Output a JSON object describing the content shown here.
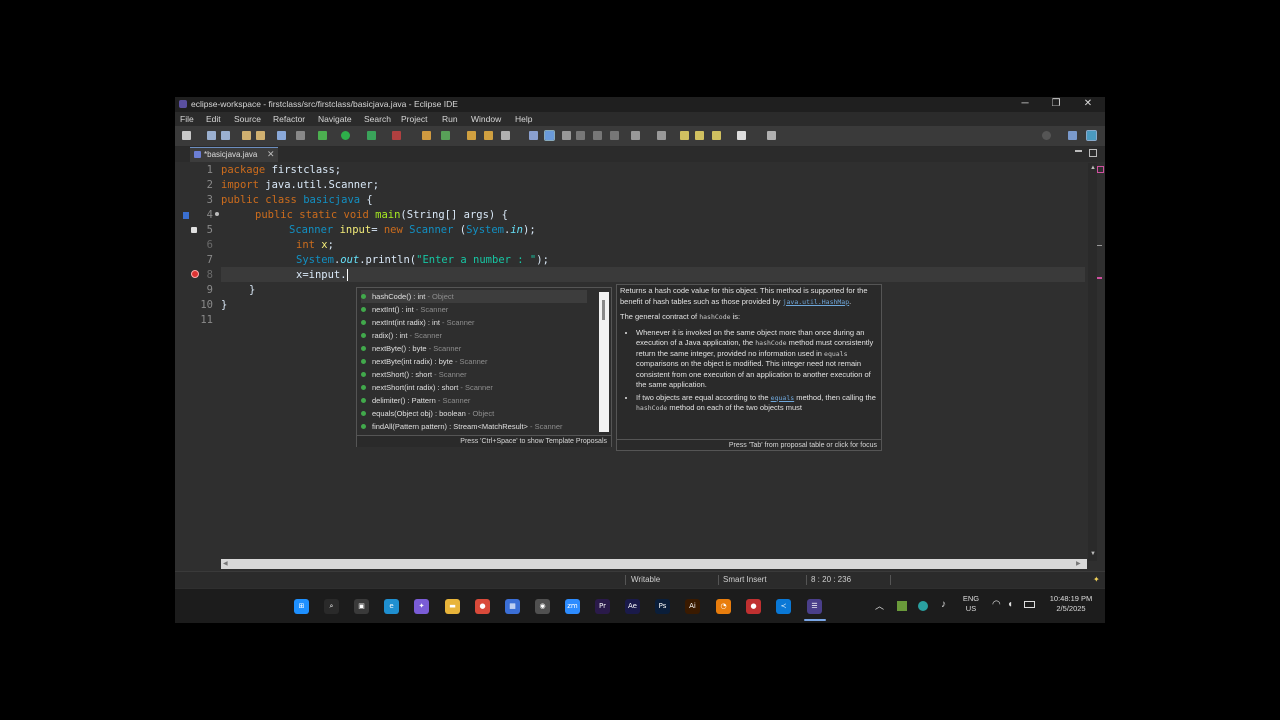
{
  "window": {
    "title": "eclipse-workspace - firstclass/src/firstclass/basicjava.java - Eclipse IDE",
    "controls": [
      "─",
      "❐",
      "✕"
    ]
  },
  "menu": [
    "File",
    "Edit",
    "Source",
    "Refactor",
    "Navigate",
    "Search",
    "Project",
    "Run",
    "Window",
    "Help"
  ],
  "editor": {
    "tab_label": "*basicjava.java",
    "tab_close": "✕",
    "line_numbers": [
      "1",
      "2",
      "3",
      "4",
      "5",
      "6",
      "7",
      "8",
      "9",
      "10",
      "11"
    ],
    "lines": {
      "l1": {
        "kw": "package",
        "rest": " firstclass;"
      },
      "l2": {
        "kw": "import",
        "rest": " java.util.Scanner;"
      },
      "l3": {
        "kw": "public class",
        "name": "basicjava",
        "rest": " {"
      },
      "l4": {
        "kw": "public static void",
        "method": "main",
        "rest": "(String[] args) {"
      },
      "l5": {
        "type": "Scanner",
        "var": "input",
        "op": "= ",
        "kw": "new",
        "type2": "Scanner",
        "paren": " (",
        "cls": "System",
        "dot": ".",
        "field": "in",
        "end": ");"
      },
      "l6": {
        "kw": "int",
        "var": "x",
        "end": ";"
      },
      "l7": {
        "cls": "System",
        "dot": ".",
        "field": "out",
        "call": ".println(",
        "str": "\"Enter a number : \"",
        "end": ");"
      },
      "l8": {
        "text": "x=input."
      },
      "l9": {
        "text": "}"
      },
      "l10": {
        "text": "}"
      }
    }
  },
  "completion": {
    "items": [
      {
        "name": "hashCode() : int",
        "qualifier": " - Object"
      },
      {
        "name": "nextInt() : int",
        "qualifier": " - Scanner"
      },
      {
        "name": "nextInt(int radix) : int",
        "qualifier": " - Scanner"
      },
      {
        "name": "radix() : int",
        "qualifier": " - Scanner"
      },
      {
        "name": "nextByte() : byte",
        "qualifier": " - Scanner"
      },
      {
        "name": "nextByte(int radix) : byte",
        "qualifier": " - Scanner"
      },
      {
        "name": "nextShort() : short",
        "qualifier": " - Scanner"
      },
      {
        "name": "nextShort(int radix) : short",
        "qualifier": " - Scanner"
      },
      {
        "name": "delimiter() : Pattern",
        "qualifier": " - Scanner"
      },
      {
        "name": "equals(Object obj) : boolean",
        "qualifier": " - Object"
      },
      {
        "name": "findAll(Pattern pattern) : Stream<MatchResult>",
        "qualifier": " - Scanner"
      }
    ],
    "footer": "Press 'Ctrl+Space' to show Template Proposals"
  },
  "javadoc": {
    "p1": "Returns a hash code value for this object. This method is supported for the benefit of hash tables such as those provided by ",
    "p1_link": "java.util.HashMap",
    "p1_end": ".",
    "p2": "The general contract of ",
    "p2_code": "hashCode",
    "p2_end": " is:",
    "b1_a": "Whenever it is invoked on the same object more than once during an execution of a Java application, the ",
    "b1_code1": "hashCode",
    "b1_b": " method must consistently return the same integer, provided no information used in ",
    "b1_code2": "equals",
    "b1_c": " comparisons on the object is modified. This integer need not remain consistent from one execution of an application to another execution of the same application.",
    "b2_a": "If two objects are equal according to the ",
    "b2_code1": "equals",
    "b2_b": " method, then calling the ",
    "b2_code2": "hashCode",
    "b2_c": " method on each of the two objects must",
    "footer": "Press 'Tab' from proposal table or click for focus"
  },
  "status": {
    "writable": "Writable",
    "insert": "Smart Insert",
    "position": "8 : 20 : 236"
  },
  "taskbar": {
    "lang": "ENG",
    "region": "US",
    "time": "10:48:19 PM",
    "date": "2/5/2025",
    "apps": [
      {
        "name": "windows-start-icon",
        "glyph": "⊞",
        "color": "#1e90ff"
      },
      {
        "name": "search-icon",
        "glyph": "⌕",
        "color": "#2a2a2a"
      },
      {
        "name": "task-view-icon",
        "glyph": "▣",
        "color": "#3a3a3a"
      },
      {
        "name": "edge-icon",
        "glyph": "e",
        "color": "#1f8fd0"
      },
      {
        "name": "copilot-icon",
        "glyph": "✦",
        "color": "#7a5cd6"
      },
      {
        "name": "file-explorer-icon",
        "glyph": "▬",
        "color": "#e8b43a"
      },
      {
        "name": "chrome-icon",
        "glyph": "●",
        "color": "#d94a3a"
      },
      {
        "name": "store-icon",
        "glyph": "▦",
        "color": "#3b6fd6"
      },
      {
        "name": "obs-icon",
        "glyph": "◉",
        "color": "#505050"
      },
      {
        "name": "zoom-icon",
        "glyph": "zm",
        "color": "#2d8cff"
      },
      {
        "name": "premiere-icon",
        "glyph": "Pr",
        "color": "#2a1a4a"
      },
      {
        "name": "after-effects-icon",
        "glyph": "Ae",
        "color": "#1a1a4a"
      },
      {
        "name": "photoshop-icon",
        "glyph": "Ps",
        "color": "#0a1e3a"
      },
      {
        "name": "illustrator-icon",
        "glyph": "Ai",
        "color": "#3a1a00"
      },
      {
        "name": "blender-icon",
        "glyph": "◔",
        "color": "#e87d0d"
      },
      {
        "name": "screen-recorder-icon",
        "glyph": "●",
        "color": "#c03030"
      },
      {
        "name": "vscode-icon",
        "glyph": "≺",
        "color": "#0a78d6"
      },
      {
        "name": "eclipse-icon",
        "glyph": "☰",
        "color": "#4a3f8a"
      }
    ]
  }
}
